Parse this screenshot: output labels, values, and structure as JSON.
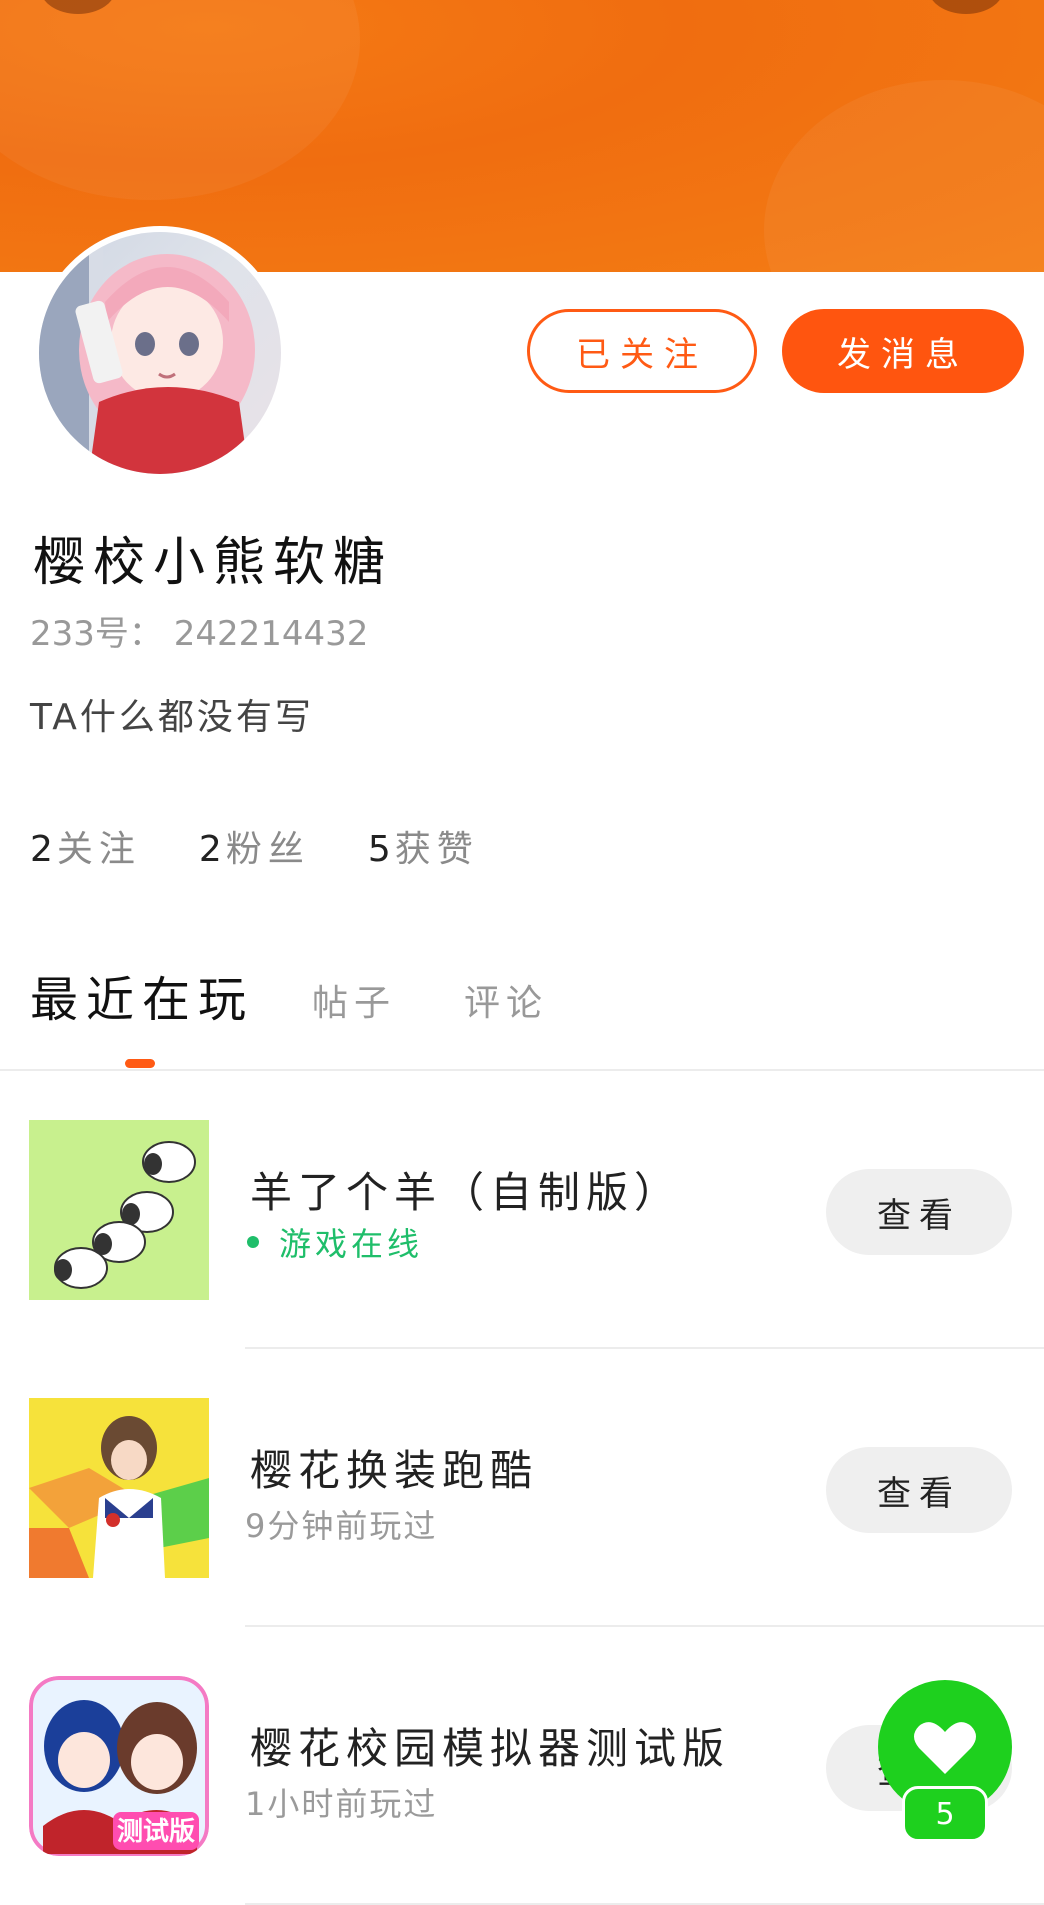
{
  "profile": {
    "nickname": "樱校小熊软糖",
    "uid": "233号： 242214432",
    "bio": "TA什么都没有写",
    "follow_status_label": "已关注",
    "message_label": "发消息"
  },
  "stats": [
    {
      "num": "2",
      "label": "关注"
    },
    {
      "num": "2",
      "label": "粉丝"
    },
    {
      "num": "5",
      "label": "获赞"
    }
  ],
  "tabs": [
    {
      "label": "最近在玩",
      "active": true
    },
    {
      "label": "帖子",
      "active": false
    },
    {
      "label": "评论",
      "active": false
    }
  ],
  "games": [
    {
      "title": "羊了个羊（自制版）",
      "status": "游戏在线",
      "online": true,
      "action": "查看"
    },
    {
      "title": "樱花换装跑酷",
      "status": "9分钟前玩过",
      "online": false,
      "action": "查看"
    },
    {
      "title": "樱花校园模拟器测试版",
      "status": "1小时前玩过",
      "online": false,
      "action": "查看",
      "badge": "测试版"
    }
  ],
  "like_fab": {
    "count": "5"
  },
  "colors": {
    "accent": "#ff5a14",
    "banner": "#f47514",
    "online": "#1fbe6a",
    "like": "#1ed01e"
  }
}
